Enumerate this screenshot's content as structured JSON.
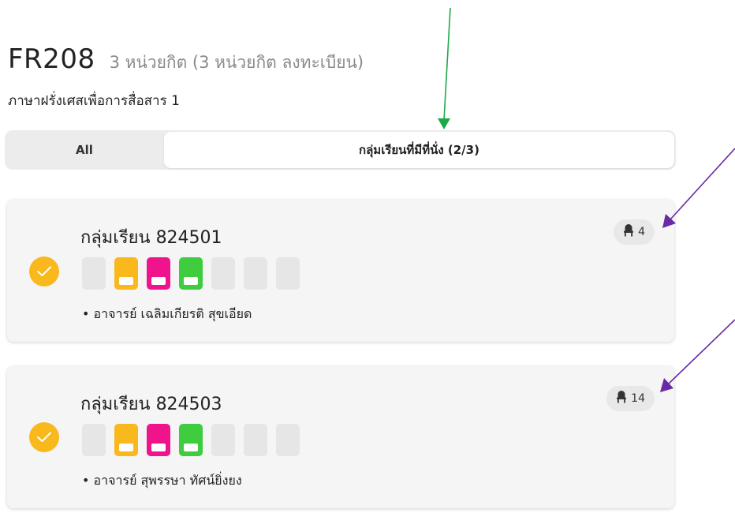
{
  "course": {
    "code": "FR208",
    "credits": "3 หน่วยกิต (3 หน่วยกิต ลงทะเบียน)",
    "name": "ภาษาฝรั่งเศสเพื่อการสื่อสาร 1"
  },
  "tabs": {
    "all_label": "All",
    "available_label": "กลุ่มเรียนที่มีที่นั่ง (2/3)",
    "selected": "available"
  },
  "sections": [
    {
      "title": "กลุ่มเรียน 824501",
      "seats": "4",
      "instructor": "• อาจารย์ เฉลิมเกียรติ สุขเอียด",
      "selected": true,
      "days": [
        "empty",
        "#f9b81c",
        "#f0148c",
        "#3fcc3f",
        "empty",
        "empty",
        "empty"
      ]
    },
    {
      "title": "กลุ่มเรียน 824503",
      "seats": "14",
      "instructor": "• อาจารย์ สุพรรษา ทัศน์ยิ่งยง",
      "selected": true,
      "days": [
        "empty",
        "#f9b81c",
        "#f0148c",
        "#3fcc3f",
        "empty",
        "empty",
        "empty"
      ]
    }
  ],
  "icons": {
    "check": "check-icon",
    "seat": "seat-icon"
  },
  "colors": {
    "check_accent": "#f9b81c",
    "annotation_green": "#1ea84a",
    "annotation_purple": "#6a2aa8"
  }
}
